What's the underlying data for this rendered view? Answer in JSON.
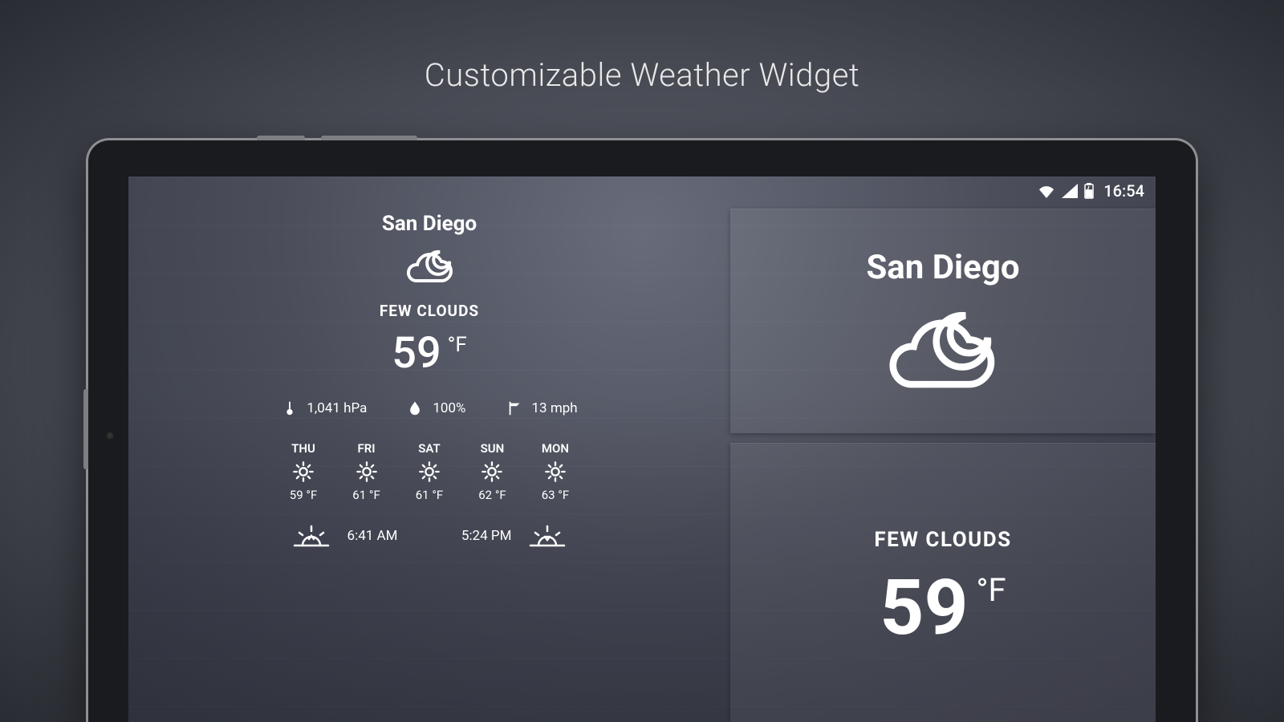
{
  "page_title": "Customizable Weather Widget",
  "statusbar": {
    "time": "16:54"
  },
  "widget_small": {
    "city": "San Diego",
    "condition": "FEW CLOUDS",
    "temp": "59",
    "unit": "°F",
    "pressure": "1,041 hPa",
    "humidity": "100%",
    "wind": "13 mph",
    "forecast": [
      {
        "day": "THU",
        "temp": "59 °F"
      },
      {
        "day": "FRI",
        "temp": "61 °F"
      },
      {
        "day": "SAT",
        "temp": "61 °F"
      },
      {
        "day": "SUN",
        "temp": "62 °F"
      },
      {
        "day": "MON",
        "temp": "63 °F"
      }
    ],
    "sunrise": "6:41 AM",
    "sunset": "5:24 PM"
  },
  "widget_large": {
    "city": "San Diego",
    "condition": "FEW CLOUDS",
    "temp": "59",
    "unit": "°F"
  }
}
